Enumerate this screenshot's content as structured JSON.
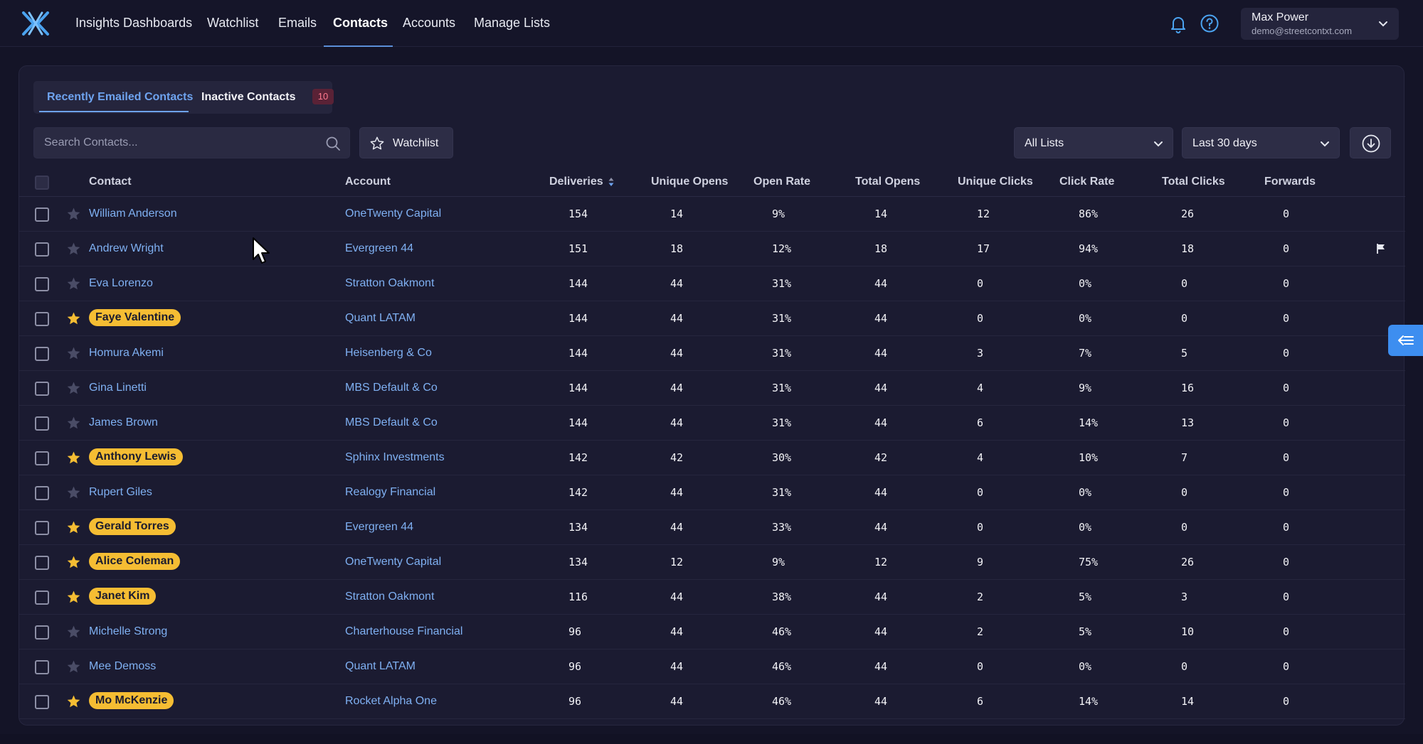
{
  "nav": {
    "items": [
      "Insights Dashboards",
      "Watchlist",
      "Emails",
      "Contacts",
      "Accounts",
      "Manage Lists"
    ],
    "active": "Contacts"
  },
  "user": {
    "name": "Max Power",
    "email": "demo@streetcontxt.com"
  },
  "tabs": {
    "recent": "Recently Emailed Contacts",
    "inactive": "Inactive Contacts",
    "inactive_count": "10"
  },
  "search": {
    "placeholder": "Search Contacts..."
  },
  "toolbar": {
    "watchlist_label": "Watchlist",
    "lists_value": "All Lists",
    "range_value": "Last 30 days"
  },
  "table": {
    "columns": [
      "Contact",
      "Account",
      "Deliveries",
      "Unique Opens",
      "Open Rate",
      "Total Opens",
      "Unique Clicks",
      "Click Rate",
      "Total Clicks",
      "Forwards"
    ],
    "rows": [
      {
        "contact": "William Anderson",
        "watched": false,
        "account": "OneTwenty Capital",
        "deliveries": "154",
        "unique_opens": "14",
        "open_rate": "9%",
        "total_opens": "14",
        "unique_clicks": "12",
        "click_rate": "86%",
        "total_clicks": "26",
        "forwards": "0",
        "flagged": false
      },
      {
        "contact": "Andrew Wright",
        "watched": false,
        "account": "Evergreen 44",
        "deliveries": "151",
        "unique_opens": "18",
        "open_rate": "12%",
        "total_opens": "18",
        "unique_clicks": "17",
        "click_rate": "94%",
        "total_clicks": "18",
        "forwards": "0",
        "flagged": true
      },
      {
        "contact": "Eva Lorenzo",
        "watched": false,
        "account": "Stratton Oakmont",
        "deliveries": "144",
        "unique_opens": "44",
        "open_rate": "31%",
        "total_opens": "44",
        "unique_clicks": "0",
        "click_rate": "0%",
        "total_clicks": "0",
        "forwards": "0",
        "flagged": false
      },
      {
        "contact": "Faye Valentine",
        "watched": true,
        "account": "Quant LATAM",
        "deliveries": "144",
        "unique_opens": "44",
        "open_rate": "31%",
        "total_opens": "44",
        "unique_clicks": "0",
        "click_rate": "0%",
        "total_clicks": "0",
        "forwards": "0",
        "flagged": false
      },
      {
        "contact": "Homura Akemi",
        "watched": false,
        "account": "Heisenberg & Co",
        "deliveries": "144",
        "unique_opens": "44",
        "open_rate": "31%",
        "total_opens": "44",
        "unique_clicks": "3",
        "click_rate": "7%",
        "total_clicks": "5",
        "forwards": "0",
        "flagged": false
      },
      {
        "contact": "Gina Linetti",
        "watched": false,
        "account": "MBS Default & Co",
        "deliveries": "144",
        "unique_opens": "44",
        "open_rate": "31%",
        "total_opens": "44",
        "unique_clicks": "4",
        "click_rate": "9%",
        "total_clicks": "16",
        "forwards": "0",
        "flagged": false
      },
      {
        "contact": "James Brown",
        "watched": false,
        "account": "MBS Default & Co",
        "deliveries": "144",
        "unique_opens": "44",
        "open_rate": "31%",
        "total_opens": "44",
        "unique_clicks": "6",
        "click_rate": "14%",
        "total_clicks": "13",
        "forwards": "0",
        "flagged": false
      },
      {
        "contact": "Anthony Lewis",
        "watched": true,
        "account": "Sphinx Investments",
        "deliveries": "142",
        "unique_opens": "42",
        "open_rate": "30%",
        "total_opens": "42",
        "unique_clicks": "4",
        "click_rate": "10%",
        "total_clicks": "7",
        "forwards": "0",
        "flagged": false
      },
      {
        "contact": "Rupert Giles",
        "watched": false,
        "account": "Realogy Financial",
        "deliveries": "142",
        "unique_opens": "44",
        "open_rate": "31%",
        "total_opens": "44",
        "unique_clicks": "0",
        "click_rate": "0%",
        "total_clicks": "0",
        "forwards": "0",
        "flagged": false
      },
      {
        "contact": "Gerald Torres",
        "watched": true,
        "account": "Evergreen 44",
        "deliveries": "134",
        "unique_opens": "44",
        "open_rate": "33%",
        "total_opens": "44",
        "unique_clicks": "0",
        "click_rate": "0%",
        "total_clicks": "0",
        "forwards": "0",
        "flagged": false
      },
      {
        "contact": "Alice Coleman",
        "watched": true,
        "account": "OneTwenty Capital",
        "deliveries": "134",
        "unique_opens": "12",
        "open_rate": "9%",
        "total_opens": "12",
        "unique_clicks": "9",
        "click_rate": "75%",
        "total_clicks": "26",
        "forwards": "0",
        "flagged": false
      },
      {
        "contact": "Janet Kim",
        "watched": true,
        "account": "Stratton Oakmont",
        "deliveries": "116",
        "unique_opens": "44",
        "open_rate": "38%",
        "total_opens": "44",
        "unique_clicks": "2",
        "click_rate": "5%",
        "total_clicks": "3",
        "forwards": "0",
        "flagged": false
      },
      {
        "contact": "Michelle Strong",
        "watched": false,
        "account": "Charterhouse Financial",
        "deliveries": "96",
        "unique_opens": "44",
        "open_rate": "46%",
        "total_opens": "44",
        "unique_clicks": "2",
        "click_rate": "5%",
        "total_clicks": "10",
        "forwards": "0",
        "flagged": false
      },
      {
        "contact": "Mee Demoss",
        "watched": false,
        "account": "Quant LATAM",
        "deliveries": "96",
        "unique_opens": "44",
        "open_rate": "46%",
        "total_opens": "44",
        "unique_clicks": "0",
        "click_rate": "0%",
        "total_clicks": "0",
        "forwards": "0",
        "flagged": false
      },
      {
        "contact": "Mo McKenzie",
        "watched": true,
        "account": "Rocket Alpha One",
        "deliveries": "96",
        "unique_opens": "44",
        "open_rate": "46%",
        "total_opens": "44",
        "unique_clicks": "6",
        "click_rate": "14%",
        "total_clicks": "14",
        "forwards": "0",
        "flagged": false
      }
    ]
  },
  "colors": {
    "accent": "#6ea3ef",
    "star_active": "#f5bd33",
    "star_inactive": "#4a4c66",
    "badge_bg": "#5a2236",
    "badge_text": "#ff7a8f"
  },
  "icons": [
    "logo-icon",
    "bell-icon",
    "help-icon",
    "chevron-down-icon",
    "search-icon",
    "star-icon",
    "download-icon",
    "flag-icon",
    "collapse-arrow-icon"
  ]
}
